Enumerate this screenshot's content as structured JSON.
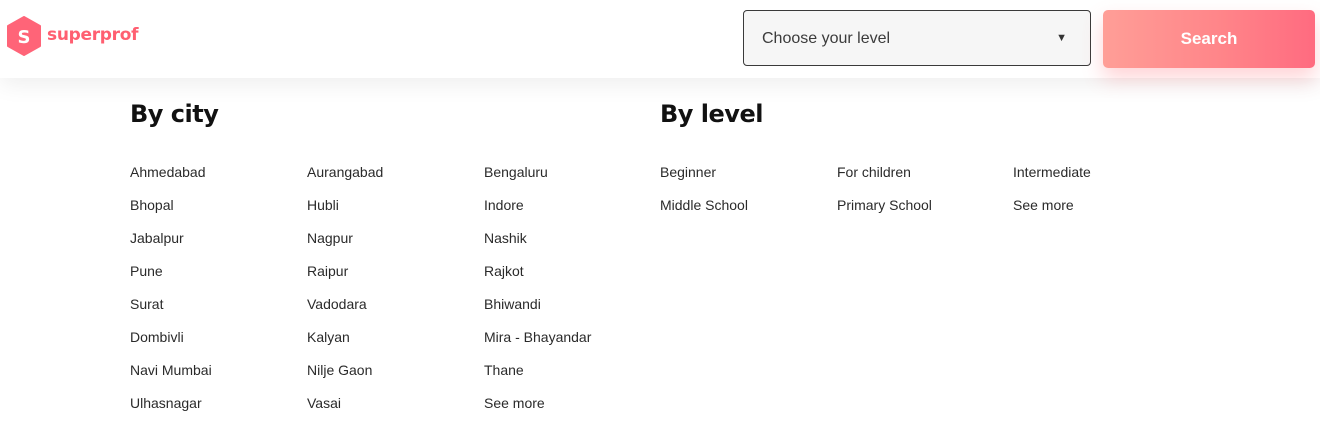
{
  "brand": {
    "logo_letter": "S",
    "name": "superprof",
    "color": "#ff5f71"
  },
  "header": {
    "level_select": {
      "label": "Choose your level",
      "caret_icon": "▼"
    },
    "search_button_label": "Search",
    "search_button_gradient": [
      "#ff9e97",
      "#ff6b80"
    ]
  },
  "by_city": {
    "title": "By city",
    "columns": [
      [
        "Ahmedabad",
        "Bhopal",
        "Jabalpur",
        "Pune",
        "Surat",
        "Dombivli",
        "Navi Mumbai",
        "Ulhasnagar"
      ],
      [
        "Aurangabad",
        "Hubli",
        "Nagpur",
        "Raipur",
        "Vadodara",
        "Kalyan",
        "Nilje Gaon",
        "Vasai"
      ],
      [
        "Bengaluru",
        "Indore",
        "Nashik",
        "Rajkot",
        "Bhiwandi",
        "Mira - Bhayandar",
        "Thane",
        "See more"
      ]
    ]
  },
  "by_level": {
    "title": "By level",
    "columns": [
      [
        "Beginner",
        "Middle School"
      ],
      [
        "For children",
        "Primary School"
      ],
      [
        "Intermediate",
        "See more"
      ]
    ]
  }
}
